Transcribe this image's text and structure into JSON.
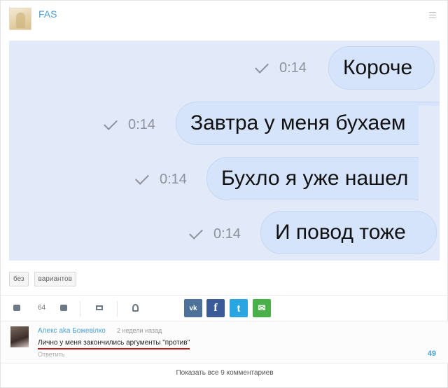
{
  "post": {
    "author": "FAS",
    "messages": [
      {
        "time": "0:14",
        "text": "Короче"
      },
      {
        "time": "0:14",
        "text": "Завтра у меня бухаем"
      },
      {
        "time": "0:14",
        "text": "Бухло я уже нашел"
      },
      {
        "time": "0:14",
        "text": "И повод тоже"
      }
    ],
    "tags": [
      "без",
      "вариантов"
    ],
    "likes": "64",
    "share": {
      "vk": "vk",
      "facebook": "f",
      "twitter": "t",
      "mail": "✉"
    }
  },
  "comment": {
    "author": "Алекс aka Божевілко",
    "time": "2 недели назад",
    "text": "Лично у меня закончились аргументы \"против\"",
    "reply_label": "Ответить",
    "score": "49"
  },
  "show_all_comments": "Показать все 9 комментариев",
  "colors": {
    "accent": "#4a9fd8",
    "bubble": "#d6e4fb",
    "image_bg": "#e2e9f8",
    "underline": "#c21a1a"
  },
  "icons": [
    "menu-icon",
    "check-icon",
    "like-icon",
    "dislike-icon",
    "repost-icon",
    "users-icon",
    "vk-icon",
    "facebook-icon",
    "twitter-icon",
    "mail-icon"
  ]
}
